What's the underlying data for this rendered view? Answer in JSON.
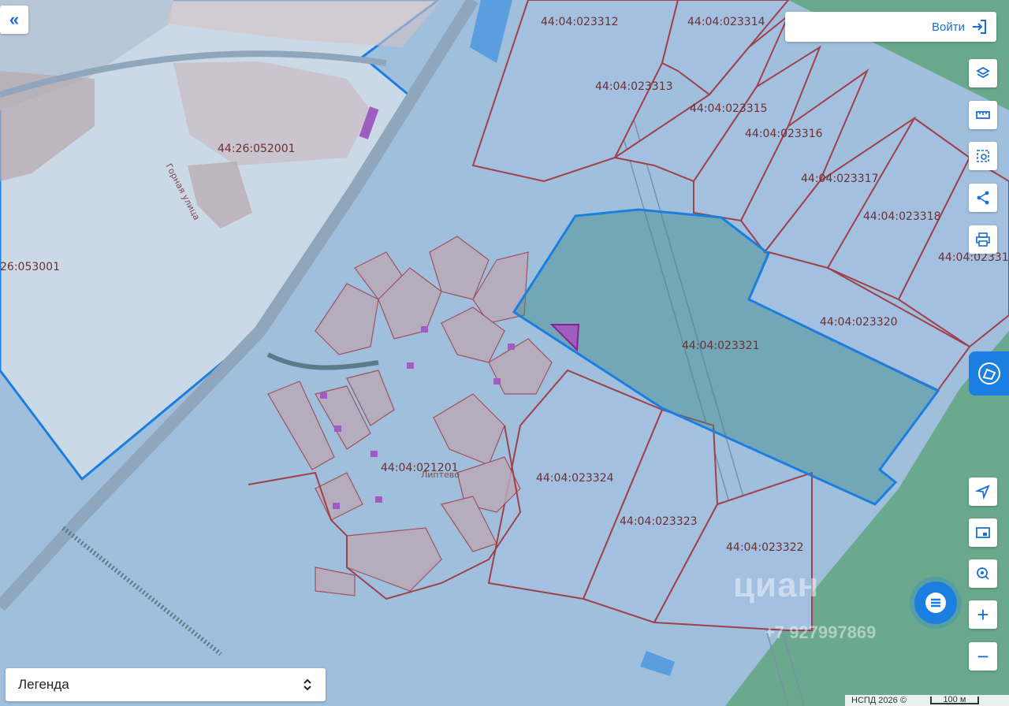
{
  "toolbar": {
    "login_label": "Войти",
    "login_icon": "login-arrow-icon",
    "collapse_icon": "double-chevron-left-icon",
    "controls": [
      "layers-icon",
      "ruler-icon",
      "select-area-icon",
      "share-icon",
      "print-icon"
    ],
    "map_controls": [
      "locate-icon",
      "picture-in-picture-icon",
      "geo-search-icon",
      "zoom-in-icon",
      "zoom-out-icon"
    ],
    "zoom_in_label": "+",
    "zoom_out_label": "−"
  },
  "legend": {
    "label": "Легенда",
    "icon": "sort-updown-icon"
  },
  "map": {
    "parcels": [
      "44:04:023312",
      "44:04:023314",
      "44:04:023313",
      "44:04:023315",
      "44:04:023316",
      "44:04:023317",
      "44:04:023318",
      "44:04:02331",
      "44:04:023320",
      "44:04:023321",
      "44:04:023324",
      "44:04:023323",
      "44:04:023322",
      "44:04:021201",
      "44:26:052001",
      "26:053001"
    ],
    "street_label": "Горная улица",
    "village_label": "Липтево",
    "colors": {
      "selected_outline": "#1a7fe0",
      "parcel_border": "#a0404a",
      "water": "#5b9ee0",
      "forest": "#5fa88a"
    }
  },
  "watermark": {
    "brand": "циан",
    "phone": "+7 927997869"
  },
  "attribution": {
    "text": "НСПД 2026 ©",
    "scale": "100 м"
  }
}
